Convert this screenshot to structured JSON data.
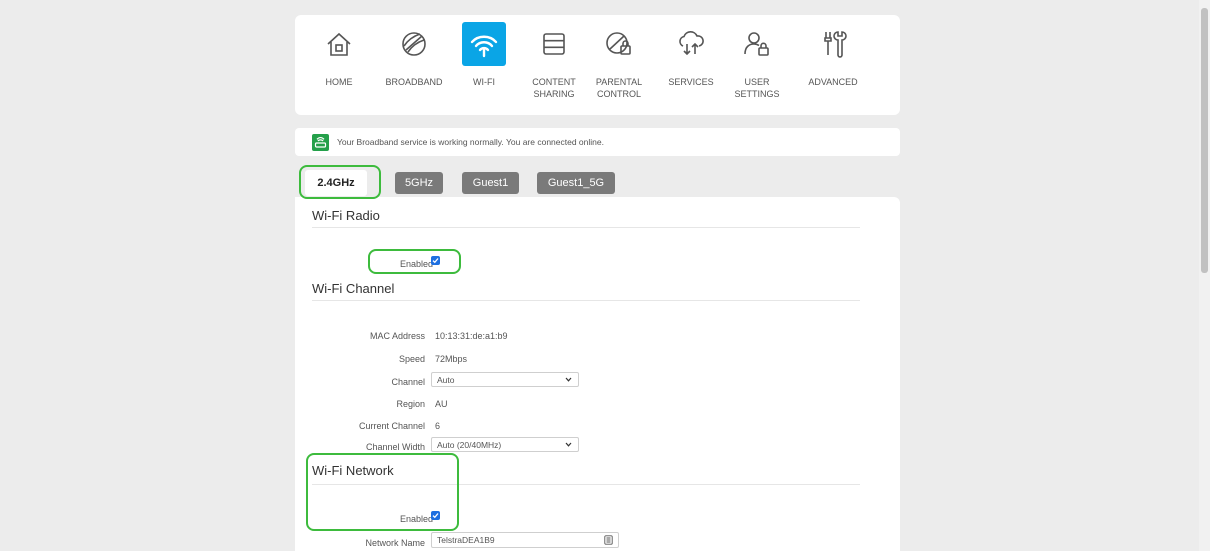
{
  "nav": {
    "items": [
      {
        "label": "HOME",
        "icon": "home-icon"
      },
      {
        "label": "BROADBAND",
        "icon": "globe-icon"
      },
      {
        "label": "WI-FI",
        "icon": "wifi-icon"
      },
      {
        "label": "CONTENT\nSHARING",
        "icon": "storage-icon"
      },
      {
        "label": "PARENTAL\nCONTROL",
        "icon": "parental-lock-icon"
      },
      {
        "label": "SERVICES",
        "icon": "cloud-transfer-icon"
      },
      {
        "label": "USER\nSETTINGS",
        "icon": "user-lock-icon"
      },
      {
        "label": "ADVANCED",
        "icon": "tools-icon"
      }
    ],
    "active": "WI-FI"
  },
  "status": {
    "text": "Your Broadband service is working normally. You are connected online.",
    "color": "#24a04a"
  },
  "tabs": [
    {
      "label": "2.4GHz",
      "active": true
    },
    {
      "label": "5GHz",
      "active": false
    },
    {
      "label": "Guest1",
      "active": false
    },
    {
      "label": "Guest1_5G",
      "active": false
    }
  ],
  "radio": {
    "title": "Wi-Fi Radio",
    "enabled_label": "Enabled",
    "enabled": true
  },
  "channel": {
    "title": "Wi-Fi Channel",
    "mac_label": "MAC Address",
    "mac_value": "10:13:31:de:a1:b9",
    "speed_label": "Speed",
    "speed_value": "72Mbps",
    "channel_label": "Channel",
    "channel_value": "Auto",
    "region_label": "Region",
    "region_value": "AU",
    "current_label": "Current Channel",
    "current_value": "6",
    "width_label": "Channel Width",
    "width_value": "Auto (20/40MHz)"
  },
  "network": {
    "title": "Wi-Fi Network",
    "enabled_label": "Enabled",
    "enabled": true,
    "name_label": "Network Name",
    "name_value": "TelstraDEA1B9"
  },
  "colors": {
    "accent": "#0aa5e6",
    "highlight": "#3dbb3d",
    "checkbox": "#1e6fe0"
  }
}
